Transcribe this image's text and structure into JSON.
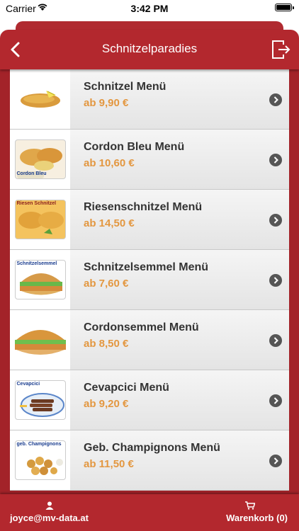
{
  "status_bar": {
    "carrier": "Carrier",
    "time": "3:42 PM"
  },
  "header": {
    "title": "Schnitzelparadies",
    "back_icon": "chevron-left-icon",
    "logout_icon": "logout-icon"
  },
  "menu_items": [
    {
      "name": "Schnitzel Menü",
      "price": "ab 9,90 €",
      "thumb_label": ""
    },
    {
      "name": "Cordon Bleu Menü",
      "price": "ab 10,60 €",
      "thumb_label": "Cordon Bleu"
    },
    {
      "name": "Riesenschnitzel Menü",
      "price": "ab 14,50 €",
      "thumb_label": "Riesen Schnitzel"
    },
    {
      "name": "Schnitzelsemmel Menü",
      "price": "ab 7,60 €",
      "thumb_label": "Schnitzelsemmel"
    },
    {
      "name": "Cordonsemmel Menü",
      "price": "ab 8,50 €",
      "thumb_label": ""
    },
    {
      "name": "Cevapcici Menü",
      "price": "ab 9,20 €",
      "thumb_label": "Cevapcici"
    },
    {
      "name": "Geb. Champignons Menü",
      "price": "ab 11,50 €",
      "thumb_label": "geb. Champignons"
    }
  ],
  "footer": {
    "user_email": "joyce@mv-data.at",
    "cart_label": "Warenkorb (0)"
  },
  "colors": {
    "brand_red": "#b3282e",
    "price_orange": "#e39740"
  }
}
